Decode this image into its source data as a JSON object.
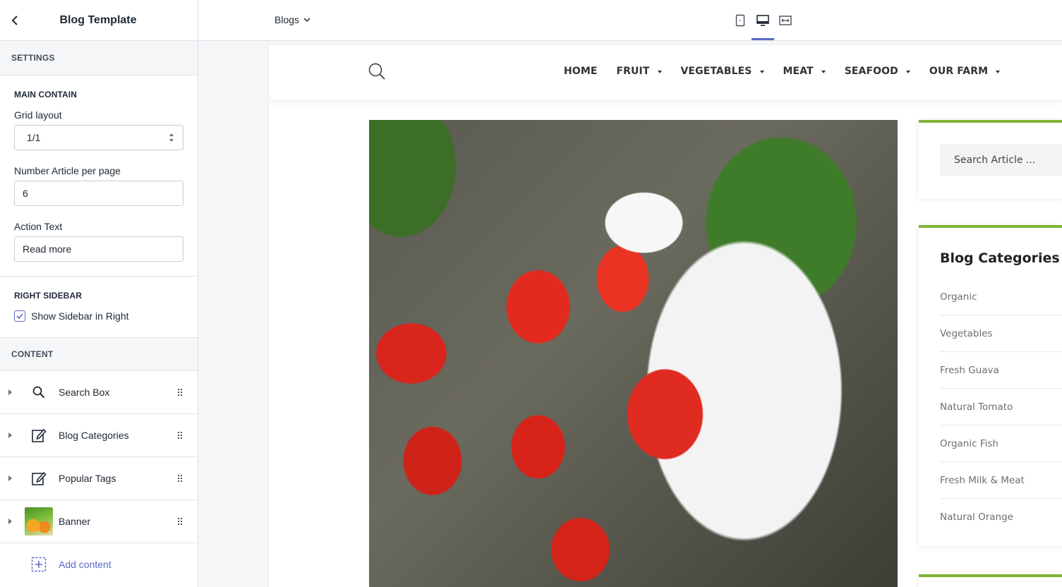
{
  "panel": {
    "title": "Blog Template",
    "settings_heading": "SETTINGS",
    "main": {
      "heading": "MAIN CONTAIN",
      "grid_label": "Grid layout",
      "grid_value": "1/1",
      "articles_label": "Number Article per page",
      "articles_value": "6",
      "action_label": "Action Text",
      "action_value": "Read more"
    },
    "right_sidebar": {
      "heading": "RIGHT SIDEBAR",
      "show_label": "Show Sidebar in Right",
      "checked": true
    },
    "content_heading": "CONTENT",
    "content_items": [
      {
        "label": "Search Box",
        "icon": "search-icon"
      },
      {
        "label": "Blog Categories",
        "icon": "edit-icon"
      },
      {
        "label": "Popular Tags",
        "icon": "edit-icon"
      },
      {
        "label": "Banner",
        "icon": "banner-thumbnail"
      }
    ],
    "add_content": "Add content"
  },
  "topbar": {
    "page_select": "Blogs",
    "devices": [
      "mobile-icon",
      "desktop-icon",
      "fullwidth-icon"
    ],
    "active_device": "desktop-icon"
  },
  "preview": {
    "nav": [
      "HOME",
      "FRUIT",
      "VEGETABLES",
      "MEAT",
      "SEAFOOD",
      "OUR FARM"
    ],
    "nav_dropdown": [
      false,
      true,
      true,
      true,
      true,
      true
    ],
    "search_placeholder": "Search Article ...",
    "categories_title": "Blog Categories",
    "categories": [
      "Organic",
      "Vegetables",
      "Fresh Guava",
      "Natural Tomato",
      "Organic Fish",
      "Fresh Milk & Meat",
      "Natural Orange"
    ],
    "accent_color": "#80b435"
  },
  "colors": {
    "primary": "#5c6ac4",
    "text": "#212b36",
    "border": "#dfe3e8"
  }
}
